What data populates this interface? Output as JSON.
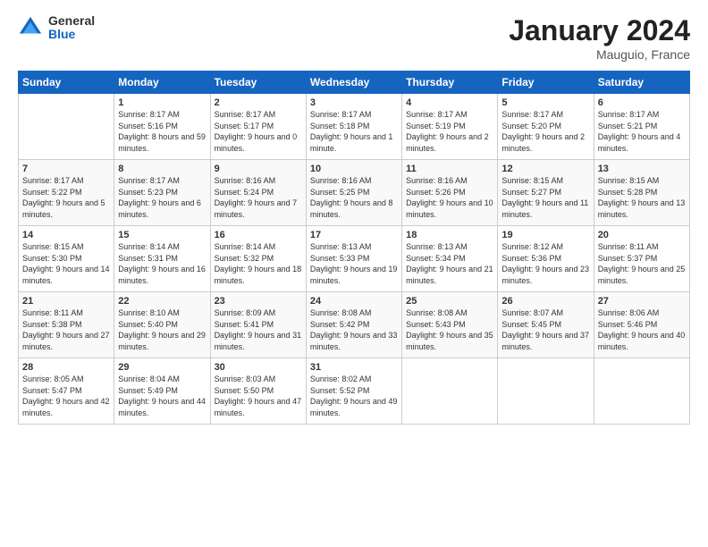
{
  "logo": {
    "general": "General",
    "blue": "Blue"
  },
  "title": "January 2024",
  "subtitle": "Mauguio, France",
  "days_of_week": [
    "Sunday",
    "Monday",
    "Tuesday",
    "Wednesday",
    "Thursday",
    "Friday",
    "Saturday"
  ],
  "weeks": [
    [
      {
        "day": "",
        "sunrise": "",
        "sunset": "",
        "daylight": ""
      },
      {
        "day": "1",
        "sunrise": "Sunrise: 8:17 AM",
        "sunset": "Sunset: 5:16 PM",
        "daylight": "Daylight: 8 hours and 59 minutes."
      },
      {
        "day": "2",
        "sunrise": "Sunrise: 8:17 AM",
        "sunset": "Sunset: 5:17 PM",
        "daylight": "Daylight: 9 hours and 0 minutes."
      },
      {
        "day": "3",
        "sunrise": "Sunrise: 8:17 AM",
        "sunset": "Sunset: 5:18 PM",
        "daylight": "Daylight: 9 hours and 1 minute."
      },
      {
        "day": "4",
        "sunrise": "Sunrise: 8:17 AM",
        "sunset": "Sunset: 5:19 PM",
        "daylight": "Daylight: 9 hours and 2 minutes."
      },
      {
        "day": "5",
        "sunrise": "Sunrise: 8:17 AM",
        "sunset": "Sunset: 5:20 PM",
        "daylight": "Daylight: 9 hours and 2 minutes."
      },
      {
        "day": "6",
        "sunrise": "Sunrise: 8:17 AM",
        "sunset": "Sunset: 5:21 PM",
        "daylight": "Daylight: 9 hours and 4 minutes."
      }
    ],
    [
      {
        "day": "7",
        "sunrise": "Sunrise: 8:17 AM",
        "sunset": "Sunset: 5:22 PM",
        "daylight": "Daylight: 9 hours and 5 minutes."
      },
      {
        "day": "8",
        "sunrise": "Sunrise: 8:17 AM",
        "sunset": "Sunset: 5:23 PM",
        "daylight": "Daylight: 9 hours and 6 minutes."
      },
      {
        "day": "9",
        "sunrise": "Sunrise: 8:16 AM",
        "sunset": "Sunset: 5:24 PM",
        "daylight": "Daylight: 9 hours and 7 minutes."
      },
      {
        "day": "10",
        "sunrise": "Sunrise: 8:16 AM",
        "sunset": "Sunset: 5:25 PM",
        "daylight": "Daylight: 9 hours and 8 minutes."
      },
      {
        "day": "11",
        "sunrise": "Sunrise: 8:16 AM",
        "sunset": "Sunset: 5:26 PM",
        "daylight": "Daylight: 9 hours and 10 minutes."
      },
      {
        "day": "12",
        "sunrise": "Sunrise: 8:15 AM",
        "sunset": "Sunset: 5:27 PM",
        "daylight": "Daylight: 9 hours and 11 minutes."
      },
      {
        "day": "13",
        "sunrise": "Sunrise: 8:15 AM",
        "sunset": "Sunset: 5:28 PM",
        "daylight": "Daylight: 9 hours and 13 minutes."
      }
    ],
    [
      {
        "day": "14",
        "sunrise": "Sunrise: 8:15 AM",
        "sunset": "Sunset: 5:30 PM",
        "daylight": "Daylight: 9 hours and 14 minutes."
      },
      {
        "day": "15",
        "sunrise": "Sunrise: 8:14 AM",
        "sunset": "Sunset: 5:31 PM",
        "daylight": "Daylight: 9 hours and 16 minutes."
      },
      {
        "day": "16",
        "sunrise": "Sunrise: 8:14 AM",
        "sunset": "Sunset: 5:32 PM",
        "daylight": "Daylight: 9 hours and 18 minutes."
      },
      {
        "day": "17",
        "sunrise": "Sunrise: 8:13 AM",
        "sunset": "Sunset: 5:33 PM",
        "daylight": "Daylight: 9 hours and 19 minutes."
      },
      {
        "day": "18",
        "sunrise": "Sunrise: 8:13 AM",
        "sunset": "Sunset: 5:34 PM",
        "daylight": "Daylight: 9 hours and 21 minutes."
      },
      {
        "day": "19",
        "sunrise": "Sunrise: 8:12 AM",
        "sunset": "Sunset: 5:36 PM",
        "daylight": "Daylight: 9 hours and 23 minutes."
      },
      {
        "day": "20",
        "sunrise": "Sunrise: 8:11 AM",
        "sunset": "Sunset: 5:37 PM",
        "daylight": "Daylight: 9 hours and 25 minutes."
      }
    ],
    [
      {
        "day": "21",
        "sunrise": "Sunrise: 8:11 AM",
        "sunset": "Sunset: 5:38 PM",
        "daylight": "Daylight: 9 hours and 27 minutes."
      },
      {
        "day": "22",
        "sunrise": "Sunrise: 8:10 AM",
        "sunset": "Sunset: 5:40 PM",
        "daylight": "Daylight: 9 hours and 29 minutes."
      },
      {
        "day": "23",
        "sunrise": "Sunrise: 8:09 AM",
        "sunset": "Sunset: 5:41 PM",
        "daylight": "Daylight: 9 hours and 31 minutes."
      },
      {
        "day": "24",
        "sunrise": "Sunrise: 8:08 AM",
        "sunset": "Sunset: 5:42 PM",
        "daylight": "Daylight: 9 hours and 33 minutes."
      },
      {
        "day": "25",
        "sunrise": "Sunrise: 8:08 AM",
        "sunset": "Sunset: 5:43 PM",
        "daylight": "Daylight: 9 hours and 35 minutes."
      },
      {
        "day": "26",
        "sunrise": "Sunrise: 8:07 AM",
        "sunset": "Sunset: 5:45 PM",
        "daylight": "Daylight: 9 hours and 37 minutes."
      },
      {
        "day": "27",
        "sunrise": "Sunrise: 8:06 AM",
        "sunset": "Sunset: 5:46 PM",
        "daylight": "Daylight: 9 hours and 40 minutes."
      }
    ],
    [
      {
        "day": "28",
        "sunrise": "Sunrise: 8:05 AM",
        "sunset": "Sunset: 5:47 PM",
        "daylight": "Daylight: 9 hours and 42 minutes."
      },
      {
        "day": "29",
        "sunrise": "Sunrise: 8:04 AM",
        "sunset": "Sunset: 5:49 PM",
        "daylight": "Daylight: 9 hours and 44 minutes."
      },
      {
        "day": "30",
        "sunrise": "Sunrise: 8:03 AM",
        "sunset": "Sunset: 5:50 PM",
        "daylight": "Daylight: 9 hours and 47 minutes."
      },
      {
        "day": "31",
        "sunrise": "Sunrise: 8:02 AM",
        "sunset": "Sunset: 5:52 PM",
        "daylight": "Daylight: 9 hours and 49 minutes."
      },
      {
        "day": "",
        "sunrise": "",
        "sunset": "",
        "daylight": ""
      },
      {
        "day": "",
        "sunrise": "",
        "sunset": "",
        "daylight": ""
      },
      {
        "day": "",
        "sunrise": "",
        "sunset": "",
        "daylight": ""
      }
    ]
  ]
}
